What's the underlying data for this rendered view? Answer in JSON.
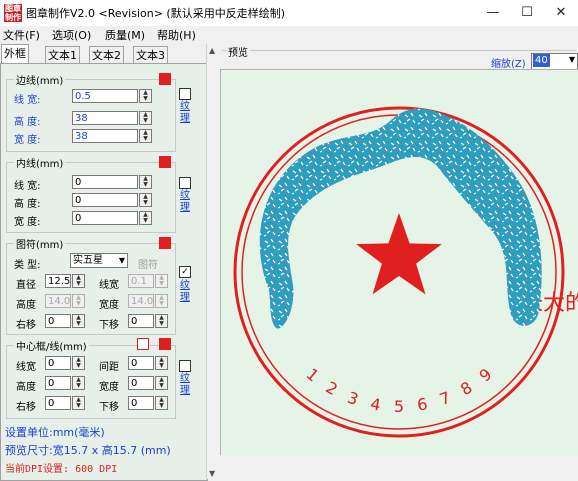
{
  "window": {
    "icon_text": "图章制作",
    "title": "图章制作V2.0 <Revision> (默认采用中反走样绘制)",
    "minimize_glyph": "—",
    "maximize_glyph": "☐",
    "close_glyph": "✕"
  },
  "menu": [
    "文件(F)",
    "选项(O)",
    "质量(M)",
    "帮助(H)"
  ],
  "tabs": [
    "外框",
    "文本1",
    "文本2",
    "文本3"
  ],
  "border_group": {
    "title": "边线(mm)",
    "color": "#e02020",
    "line_width_label": "线 宽:",
    "line_width_value": "0.5",
    "height_label": "高 度:",
    "height_value": "38",
    "width_label": "宽 度:",
    "width_value": "38",
    "texture_label": "纹理"
  },
  "inner_group": {
    "title": "内线(mm)",
    "color": "#e02020",
    "line_width_label": "线 宽:",
    "line_width_value": "0",
    "height_label": "高 度:",
    "height_value": "0",
    "width_label": "宽 度:",
    "width_value": "0",
    "texture_label": "纹理"
  },
  "symbol_group": {
    "title": "图符(mm)",
    "color": "#e02020",
    "type_label": "类 型:",
    "type_value": "实五星",
    "image_label": "图符",
    "diameter_label": "直径",
    "diameter_value": "12.5",
    "line_width_label": "线宽",
    "line_width_value": "0.1",
    "height_label": "高度",
    "height_value": "14.0",
    "width_label": "宽度",
    "width_value": "14.0",
    "right_shift_label": "右移",
    "right_shift_value": "0",
    "down_shift_label": "下移",
    "down_shift_value": "0",
    "texture_label": "纹理",
    "texture_checked": true
  },
  "center_group": {
    "title": "中心框/线(mm)",
    "color": "#e02020",
    "line_width_label": "线宽",
    "line_width_value": "0",
    "spacing_label": "间距",
    "spacing_value": "0",
    "height_label": "高度",
    "height_value": "0",
    "width_label": "宽度",
    "width_value": "0",
    "right_shift_label": "右移",
    "right_shift_value": "0",
    "down_shift_label": "下移",
    "down_shift_value": "0",
    "texture_label": "纹理"
  },
  "status": {
    "units": "设置单位:mm(毫米)",
    "preview_size": "预览尺寸:宽15.7 x 高15.7 (mm)",
    "dpi": "当前DPI设置: 600 DPI"
  },
  "preview": {
    "header": "预览",
    "zoom_label": "缩放(Z)",
    "zoom_value": "40",
    "stamp_color": "#e02020",
    "texture_color": "#2a9fc0",
    "top_text": "长大的",
    "bottom_digits": [
      "1",
      "2",
      "3",
      "4",
      "5",
      "6",
      "7",
      "8",
      "9"
    ]
  }
}
